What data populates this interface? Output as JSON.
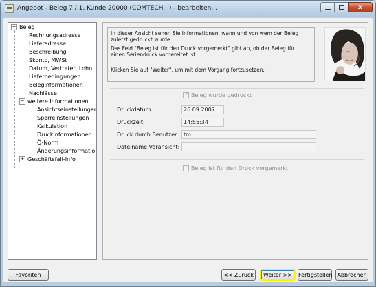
{
  "window": {
    "title": "Angebot - Beleg 7 / 1, Kunde 20000 (COMTECH...) - bearbeiten...",
    "close_glyph": "x"
  },
  "tree": {
    "root": "Beleg",
    "items": [
      "Rechnungsadresse",
      "Lieferadresse",
      "Beschreibung",
      "Skonto, MWSt",
      "Datum, Vertreter, Lohn",
      "Lieferbedingungen",
      "Beleginformationen",
      "Nachlässe"
    ],
    "sub_group": "weitere Informationen",
    "sub_items": [
      "Ansichtseinstellungen",
      "Sperreinstellungen",
      "Kalkulation",
      "Druckinformationen",
      "Ö-Norm",
      "Änderungsinformationen"
    ],
    "last": "Geschäftsfall-Info",
    "selected": "Druckinformationen",
    "expanded_glyph": "−",
    "collapsed_glyph": "+"
  },
  "info": {
    "p1": "In dieser Ansicht sehen Sie Informationen, wann und von wem der Beleg zuletzt gedruckt wurde.",
    "p2": "Das Feld \"Beleg ist für den Druck vorgemerkt\" gibt an, ob der Beleg für einen Seriendruck vorbereitet ist.",
    "p3": "Klicken Sie auf \"Weiter\", um mit dem Vorgang fortzusetzen."
  },
  "print": {
    "printed_label": "Beleg wurde gedruckt",
    "printed_checked": true,
    "date_label": "Druckdatum:",
    "date_value": "26.09.2007",
    "time_label": "Druckzeit:",
    "time_value": "14:55:34",
    "user_label": "Druck durch Benutzer:",
    "user_value": "tm",
    "file_label": "Dateiname Voransicht:",
    "file_value": "",
    "marked_label": "Beleg ist für den Druck vorgemerkt",
    "marked_checked": false
  },
  "buttons": {
    "favorites": "Favoriten",
    "back": "<< Zurück",
    "next": "Weiter >>",
    "finish": "Fertigstellen",
    "cancel": "Abbrechen"
  }
}
